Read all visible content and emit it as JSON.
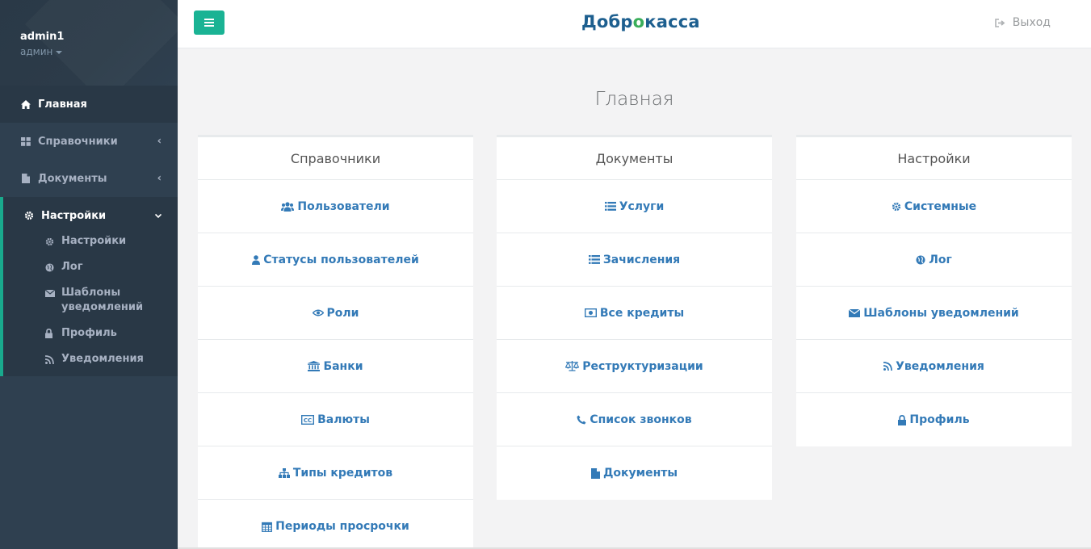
{
  "profile": {
    "username": "admin1",
    "role": "админ"
  },
  "sidebar": {
    "items": [
      {
        "label": "Главная",
        "icon": "home-icon"
      },
      {
        "label": "Справочники",
        "icon": "th-large-icon"
      },
      {
        "label": "Документы",
        "icon": "file-icon"
      },
      {
        "label": "Настройки",
        "icon": "gear-icon"
      }
    ],
    "submenu": [
      {
        "label": "Настройки",
        "icon": "gear-icon"
      },
      {
        "label": "Лог",
        "icon": "globe-icon"
      },
      {
        "label": "Шаблоны уведомлений",
        "icon": "envelope-icon"
      },
      {
        "label": "Профиль",
        "icon": "lock-icon"
      },
      {
        "label": "Уведомления",
        "icon": "rss-icon"
      }
    ]
  },
  "header": {
    "logo_left": "Добр",
    "logo_o": "о",
    "logo_right": "касса",
    "logout": "Выход"
  },
  "main": {
    "title": "Главная",
    "panels": [
      {
        "title": "Справочники",
        "items": [
          {
            "label": "Пользователи",
            "icon": "users-icon"
          },
          {
            "label": "Статусы пользователей",
            "icon": "user-icon"
          },
          {
            "label": "Роли",
            "icon": "eye-icon"
          },
          {
            "label": "Банки",
            "icon": "bank-icon"
          },
          {
            "label": "Валюты",
            "icon": "cc-icon"
          },
          {
            "label": "Типы кредитов",
            "icon": "sitemap-icon"
          },
          {
            "label": "Периоды просрочки",
            "icon": "calendar-icon"
          }
        ]
      },
      {
        "title": "Документы",
        "items": [
          {
            "label": "Услуги",
            "icon": "list-icon"
          },
          {
            "label": "Зачисления",
            "icon": "list-icon"
          },
          {
            "label": "Все кредиты",
            "icon": "money-icon"
          },
          {
            "label": "Реструктуризации",
            "icon": "balance-scale-icon"
          },
          {
            "label": "Список звонков",
            "icon": "phone-icon"
          },
          {
            "label": "Документы",
            "icon": "file-icon"
          }
        ]
      },
      {
        "title": "Настройки",
        "items": [
          {
            "label": "Системные",
            "icon": "gear-icon"
          },
          {
            "label": "Лог",
            "icon": "globe-icon"
          },
          {
            "label": "Шаблоны уведомлений",
            "icon": "envelope-icon"
          },
          {
            "label": "Уведомления",
            "icon": "rss-icon"
          },
          {
            "label": "Профиль",
            "icon": "lock-icon"
          }
        ]
      }
    ]
  },
  "colors": {
    "sidebar": "#2f4050",
    "accent": "#1ab394",
    "link": "#337ab7",
    "background": "#f3f3f4"
  }
}
